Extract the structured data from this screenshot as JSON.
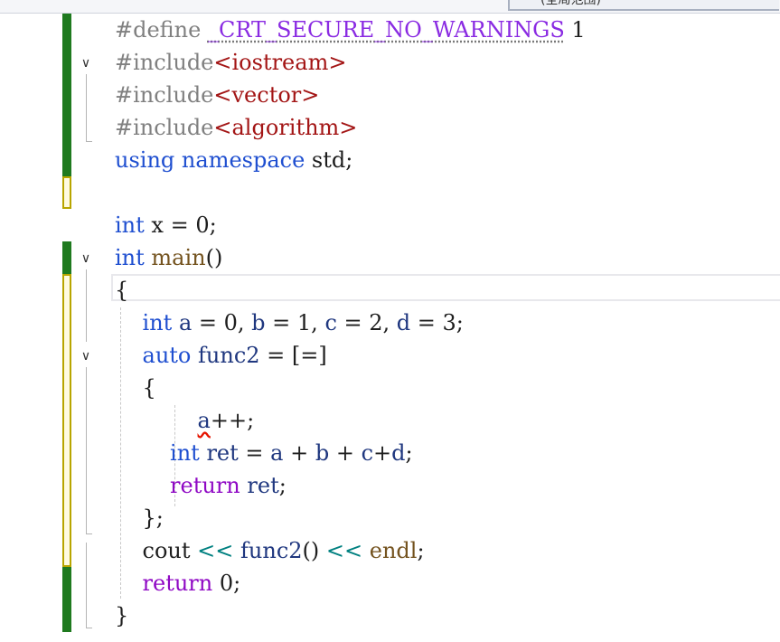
{
  "window": {
    "scope_dropdown_label": "(全局范围)"
  },
  "code": {
    "lines": [
      {
        "tokens": [
          {
            "t": "#define ",
            "c": "pp"
          },
          {
            "t": "_CRT_SECURE_NO_WARNINGS",
            "c": "macro"
          },
          {
            "t": " 1",
            "c": "plain"
          }
        ]
      },
      {
        "tokens": [
          {
            "t": "#include",
            "c": "pp"
          },
          {
            "t": "<iostream>",
            "c": "str"
          }
        ]
      },
      {
        "tokens": [
          {
            "t": "#include",
            "c": "pp"
          },
          {
            "t": "<vector>",
            "c": "str"
          }
        ]
      },
      {
        "tokens": [
          {
            "t": "#include",
            "c": "pp"
          },
          {
            "t": "<algorithm>",
            "c": "str"
          }
        ]
      },
      {
        "tokens": [
          {
            "t": "using",
            "c": "kw"
          },
          {
            "t": " ",
            "c": "plain"
          },
          {
            "t": "namespace",
            "c": "kw"
          },
          {
            "t": " std;",
            "c": "plain"
          }
        ]
      },
      {
        "tokens": []
      },
      {
        "tokens": [
          {
            "t": "int",
            "c": "kw"
          },
          {
            "t": " x = 0;",
            "c": "plain"
          }
        ]
      },
      {
        "tokens": [
          {
            "t": "int",
            "c": "kw"
          },
          {
            "t": " ",
            "c": "plain"
          },
          {
            "t": "main",
            "c": "fn"
          },
          {
            "t": "()",
            "c": "plain"
          }
        ]
      },
      {
        "tokens": [
          {
            "t": "{",
            "c": "plain"
          }
        ]
      },
      {
        "tokens": [
          {
            "t": "    ",
            "c": "plain"
          },
          {
            "t": "int",
            "c": "kw"
          },
          {
            "t": " ",
            "c": "plain"
          },
          {
            "t": "a",
            "c": "local"
          },
          {
            "t": " = 0, ",
            "c": "plain"
          },
          {
            "t": "b",
            "c": "local"
          },
          {
            "t": " = 1, ",
            "c": "plain"
          },
          {
            "t": "c",
            "c": "local"
          },
          {
            "t": " = 2, ",
            "c": "plain"
          },
          {
            "t": "d",
            "c": "local"
          },
          {
            "t": " = 3;",
            "c": "plain"
          }
        ]
      },
      {
        "tokens": [
          {
            "t": "    ",
            "c": "plain"
          },
          {
            "t": "auto",
            "c": "kw"
          },
          {
            "t": " ",
            "c": "plain"
          },
          {
            "t": "func2",
            "c": "local"
          },
          {
            "t": " = [=]",
            "c": "plain"
          }
        ]
      },
      {
        "tokens": [
          {
            "t": "    {",
            "c": "plain"
          }
        ]
      },
      {
        "tokens": [
          {
            "t": "            ",
            "c": "plain"
          },
          {
            "t": "a",
            "c": "local",
            "squiggle": "red"
          },
          {
            "t": "++;",
            "c": "plain"
          }
        ]
      },
      {
        "tokens": [
          {
            "t": "        ",
            "c": "plain"
          },
          {
            "t": "int",
            "c": "kw"
          },
          {
            "t": " ",
            "c": "plain"
          },
          {
            "t": "ret",
            "c": "local"
          },
          {
            "t": " = ",
            "c": "plain"
          },
          {
            "t": "a",
            "c": "local"
          },
          {
            "t": " + ",
            "c": "plain"
          },
          {
            "t": "b",
            "c": "local"
          },
          {
            "t": " + ",
            "c": "plain"
          },
          {
            "t": "c",
            "c": "local"
          },
          {
            "t": "+",
            "c": "plain"
          },
          {
            "t": "d",
            "c": "local"
          },
          {
            "t": ";",
            "c": "plain"
          }
        ]
      },
      {
        "tokens": [
          {
            "t": "        ",
            "c": "plain"
          },
          {
            "t": "return",
            "c": "ctl"
          },
          {
            "t": " ",
            "c": "plain"
          },
          {
            "t": "ret",
            "c": "local"
          },
          {
            "t": ";",
            "c": "plain"
          }
        ]
      },
      {
        "tokens": [
          {
            "t": "    };",
            "c": "plain"
          }
        ]
      },
      {
        "tokens": [
          {
            "t": "    ",
            "c": "plain"
          },
          {
            "t": "cout",
            "c": "plain"
          },
          {
            "t": " ",
            "c": "plain"
          },
          {
            "t": "<<",
            "c": "op"
          },
          {
            "t": " ",
            "c": "plain"
          },
          {
            "t": "func2",
            "c": "local"
          },
          {
            "t": "() ",
            "c": "plain"
          },
          {
            "t": "<<",
            "c": "op"
          },
          {
            "t": " ",
            "c": "plain"
          },
          {
            "t": "endl",
            "c": "fn"
          },
          {
            "t": ";",
            "c": "plain"
          }
        ]
      },
      {
        "tokens": [
          {
            "t": "    ",
            "c": "plain"
          },
          {
            "t": "return",
            "c": "ctl"
          },
          {
            "t": " 0;",
            "c": "plain"
          }
        ]
      },
      {
        "tokens": [
          {
            "t": "}",
            "c": "plain"
          }
        ]
      }
    ]
  },
  "colors": {
    "keyword": "#1f4fd0",
    "control_keyword": "#8f08c4",
    "preprocessor": "#808080",
    "macro": "#8a2be2",
    "include_path": "#a31515",
    "function": "#74531f",
    "local_variable": "#1f377f",
    "operator": "#008080",
    "saved_change_bar": "#1f7a1f",
    "unsaved_change_bar": "#b8a500",
    "error_squiggle": "#e51400"
  }
}
